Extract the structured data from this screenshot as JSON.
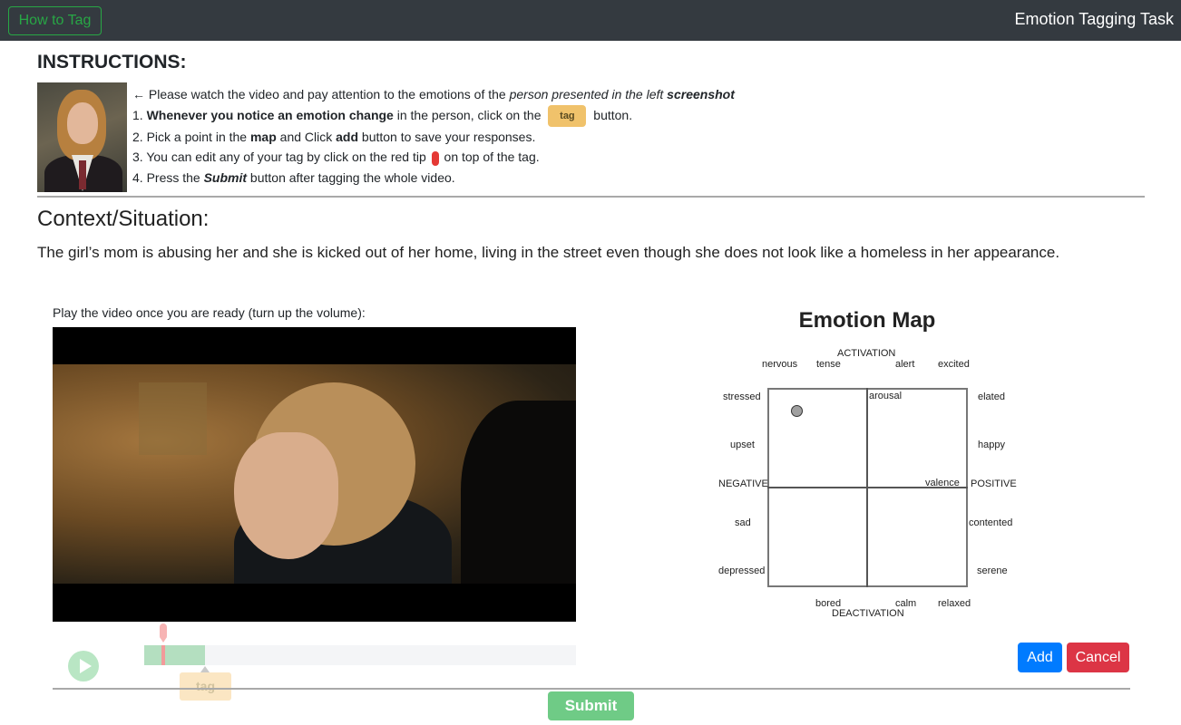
{
  "navbar": {
    "how_to_tag_label": "How to Tag",
    "title": "Emotion Tagging Task"
  },
  "instructions": {
    "heading": "INSTRUCTIONS:",
    "line0": {
      "prefix": "← Please watch the video and pay attention to the emotions of the ",
      "emphasis": "person presented in the left ",
      "emphasis_bold": "screenshot"
    },
    "line1": {
      "prefix": "1. ",
      "bold": "Whenever you notice an emotion change",
      "middle": " in the person, click on the",
      "tag_chip": "tag",
      "suffix": "button."
    },
    "line2": {
      "prefix": "2. Pick a point in the ",
      "bold1": "map",
      "middle": " and Click ",
      "bold2": "add",
      "suffix": " button to save your responses."
    },
    "line3": {
      "prefix": "3. You can edit any of your tag by click on the red tip",
      "suffix": "on top of the tag."
    },
    "line4": {
      "prefix": "4. Press the ",
      "bold_italic": "Submit",
      "suffix": " button after tagging the whole video."
    }
  },
  "context": {
    "heading": "Context/Situation:",
    "text": "The girl’s mom is abusing her and she is kicked out of her home, living in the street even though she does not look like a homeless in her appearance."
  },
  "video": {
    "hint": "Play the video once you are ready (turn up the volume):",
    "progress_fraction": 0.14,
    "tag_label": "tag"
  },
  "emotion_map": {
    "title": "Emotion Map",
    "labels": {
      "activation": "ACTIVATION",
      "deactivation": "DEACTIVATION",
      "negative": "NEGATIVE",
      "positive": "POSITIVE",
      "arousal": "arousal",
      "valence": "valence",
      "nervous": "nervous",
      "tense": "tense",
      "alert": "alert",
      "excited": "excited",
      "stressed": "stressed",
      "elated": "elated",
      "upset": "upset",
      "happy": "happy",
      "sad": "sad",
      "contented": "contented",
      "depressed": "depressed",
      "serene": "serene",
      "bored": "bored",
      "calm": "calm",
      "relaxed": "relaxed"
    }
  },
  "actions": {
    "add_label": "Add",
    "cancel_label": "Cancel",
    "submit_label": "Submit"
  },
  "colors": {
    "navbar_bg": "#343a40",
    "outline_success": "#28a745",
    "add_blue": "#007bff",
    "cancel_red": "#dc3545",
    "submit_green": "#6fcb86",
    "tag_yellow": "#f0c26b",
    "red_tip": "#e53935"
  }
}
